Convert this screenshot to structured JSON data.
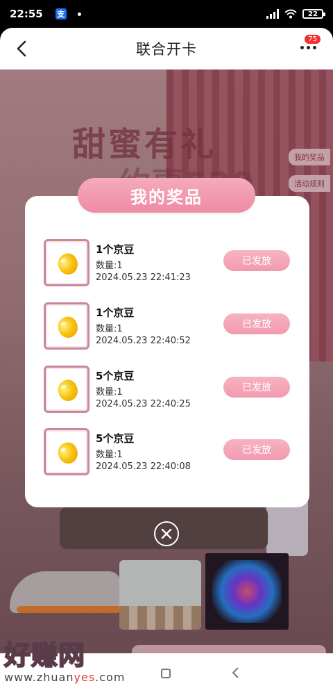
{
  "status_bar": {
    "time": "22:55",
    "app_glyph": "支",
    "battery": "22"
  },
  "header": {
    "title": "联合开卡",
    "notification_count": "75"
  },
  "background": {
    "banner_title": "甜蜜有礼",
    "banner_subtitle": "约惠520",
    "side_buttons": [
      "我的奖品",
      "活动规则"
    ]
  },
  "modal": {
    "title": "我的奖品",
    "prizes": [
      {
        "name": "1个京豆",
        "qty": "数量:1",
        "time": "2024.05.23 22:41:23",
        "status": "已发放"
      },
      {
        "name": "1个京豆",
        "qty": "数量:1",
        "time": "2024.05.23 22:40:52",
        "status": "已发放"
      },
      {
        "name": "5个京豆",
        "qty": "数量:1",
        "time": "2024.05.23 22:40:25",
        "status": "已发放"
      },
      {
        "name": "5个京豆",
        "qty": "数量:1",
        "time": "2024.05.23 22:40:08",
        "status": "已发放"
      }
    ]
  },
  "watermark": {
    "text": "好赚网",
    "url_prefix": "www.zhuan",
    "url_highlight": "yes",
    "url_suffix": ".com"
  },
  "colors": {
    "accent_pink": "#f29ab0",
    "badge_red": "#f23030"
  }
}
